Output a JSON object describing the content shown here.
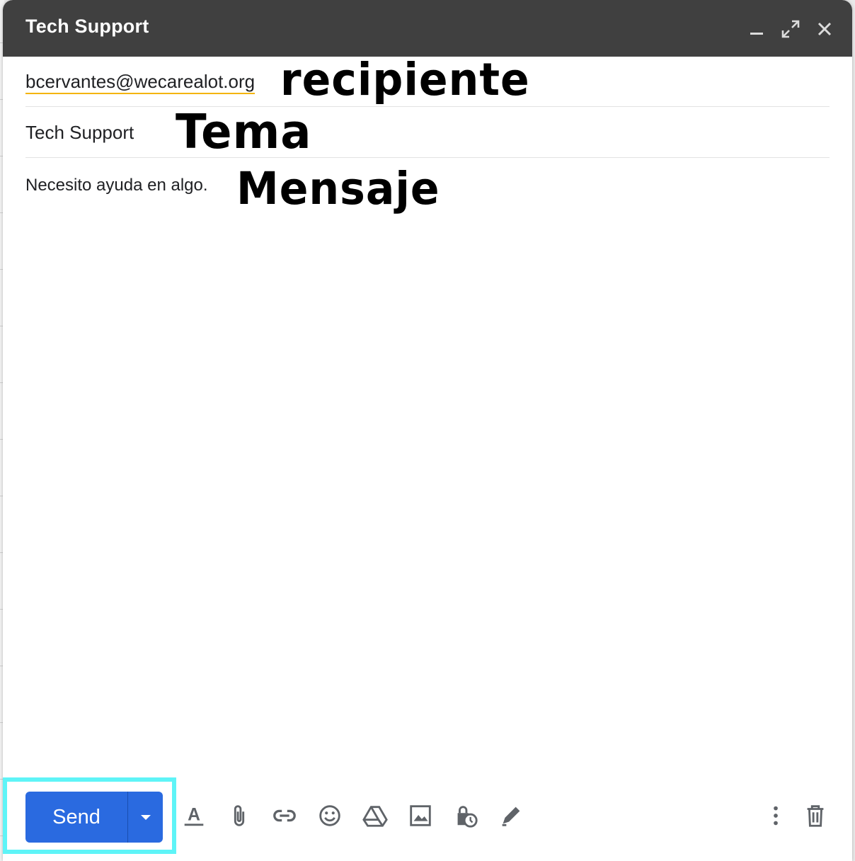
{
  "window": {
    "title": "Tech Support"
  },
  "compose": {
    "recipient": "bcervantes@wecarealot.org",
    "subject": "Tech Support",
    "body": "Necesito ayuda en algo."
  },
  "annotations": {
    "recipient_label": "recipiente",
    "subject_label": "Tema",
    "message_label": "Mensaje"
  },
  "toolbar": {
    "send_label": "Send",
    "icons": [
      "formatting-icon",
      "attach-icon",
      "link-icon",
      "emoji-icon",
      "drive-icon",
      "photo-icon",
      "confidential-icon",
      "signature-icon",
      "more-options-icon",
      "discard-icon"
    ]
  },
  "colors": {
    "titlebar": "#404040",
    "send_button": "#2a6ae0",
    "highlight": "#5ef4f7",
    "recipient_underline": "#f4b400"
  }
}
